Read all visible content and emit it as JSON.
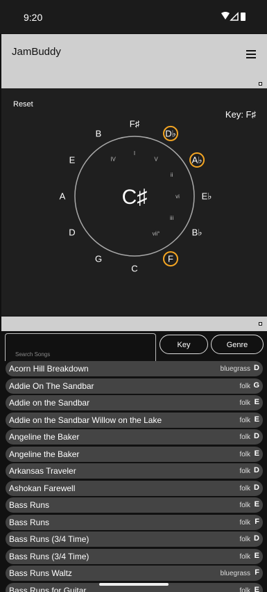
{
  "status_bar": {
    "time": "9:20"
  },
  "app": {
    "title": "JamBuddy"
  },
  "circle": {
    "reset_label": "Reset",
    "key_label": "Key: F♯",
    "center_key": "C♯",
    "highlight_color": "#f5a623",
    "outer_notes": [
      {
        "label": "F♯",
        "highlighted": false
      },
      {
        "label": "D♭",
        "highlighted": true
      },
      {
        "label": "A♭",
        "highlighted": true
      },
      {
        "label": "E♭",
        "highlighted": false
      },
      {
        "label": "B♭",
        "highlighted": false
      },
      {
        "label": "F",
        "highlighted": true
      },
      {
        "label": "C",
        "highlighted": false
      },
      {
        "label": "G",
        "highlighted": false
      },
      {
        "label": "D",
        "highlighted": false
      },
      {
        "label": "A",
        "highlighted": false
      },
      {
        "label": "E",
        "highlighted": false
      },
      {
        "label": "B",
        "highlighted": false
      }
    ],
    "roman_numerals": [
      "I",
      "V",
      "ii",
      "vi",
      "iii",
      "vii°",
      "IV"
    ]
  },
  "search": {
    "placeholder": "Search Songs",
    "value": ""
  },
  "filters": {
    "key_label": "Key",
    "genre_label": "Genre"
  },
  "songs": [
    {
      "title": "Acorn Hill Breakdown",
      "genre": "bluegrass",
      "key": "D"
    },
    {
      "title": "Addie On The Sandbar",
      "genre": "folk",
      "key": "G"
    },
    {
      "title": "Addie on the Sandbar",
      "genre": "folk",
      "key": "E"
    },
    {
      "title": "Addie on the Sandbar Willow on the Lake",
      "genre": "folk",
      "key": "E"
    },
    {
      "title": "Angeline the Baker",
      "genre": "folk",
      "key": "D"
    },
    {
      "title": "Angeline the Baker",
      "genre": "folk",
      "key": "E"
    },
    {
      "title": "Arkansas Traveler",
      "genre": "folk",
      "key": "D"
    },
    {
      "title": "Ashokan Farewell",
      "genre": "folk",
      "key": "D"
    },
    {
      "title": "Bass Runs",
      "genre": "folk",
      "key": "E"
    },
    {
      "title": "Bass Runs",
      "genre": "folk",
      "key": "F"
    },
    {
      "title": "Bass Runs (3/4 Time)",
      "genre": "folk",
      "key": "D"
    },
    {
      "title": "Bass Runs (3/4 Time)",
      "genre": "folk",
      "key": "E"
    },
    {
      "title": "Bass Runs Waltz",
      "genre": "bluegrass",
      "key": "F"
    },
    {
      "title": "Bass Runs for Guitar",
      "genre": "folk",
      "key": "E"
    }
  ]
}
